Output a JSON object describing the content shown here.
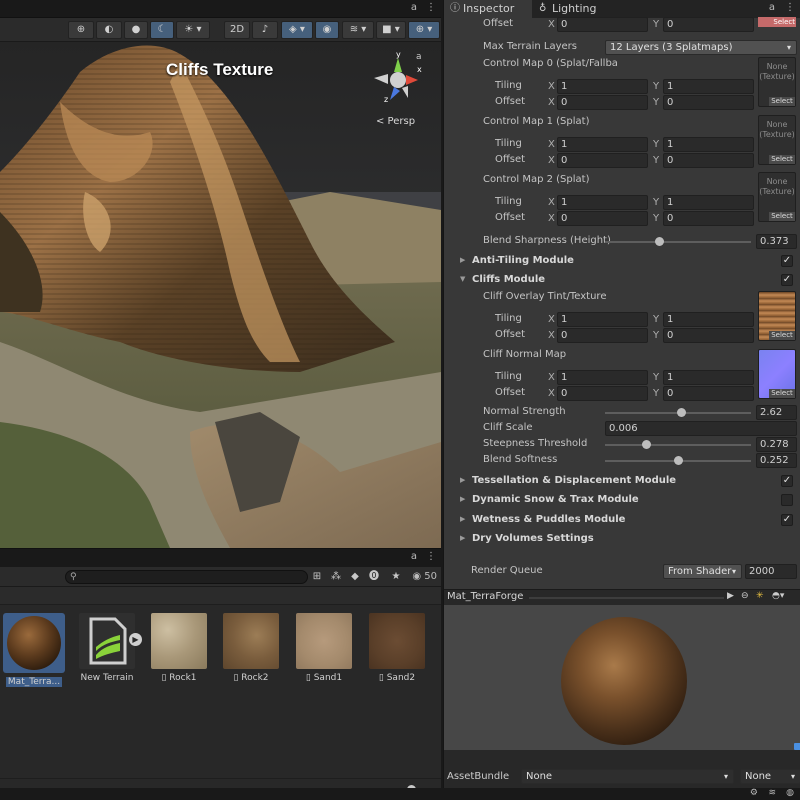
{
  "scene": {
    "overlay_title": "Cliffs Texture",
    "projection_label": "< Persp",
    "gizmo_axes": {
      "x": "x",
      "y": "y",
      "z": "z"
    },
    "toolbar_icons": [
      "globe-icon",
      "gizmo-mode-icon",
      "shaded-sphere-icon",
      "moon-icon",
      "sun-icon",
      "2d-icon",
      "audio-icon",
      "fx-layers-icon",
      "visibility-icon",
      "layers-icon",
      "camera-icon",
      "gizmos-icon"
    ],
    "toolbar_label_2d": "2D",
    "lock_glyph": "a",
    "menu_glyph": "⋮"
  },
  "project": {
    "search_placeholder": "",
    "hidden_count": "50",
    "assets": [
      {
        "label": "Mat_Terra...",
        "kind": "material",
        "selected": true
      },
      {
        "label": "New Terrain",
        "kind": "terrain",
        "selected": false
      },
      {
        "label": "Rock1",
        "kind": "texture",
        "selected": false
      },
      {
        "label": "Rock2",
        "kind": "texture",
        "selected": false
      },
      {
        "label": "Sand1",
        "kind": "texture",
        "selected": false
      },
      {
        "label": "Sand2",
        "kind": "texture",
        "selected": false
      }
    ]
  },
  "inspector": {
    "tabs": [
      {
        "label": "Inspector",
        "icon": "info-icon",
        "active": true
      },
      {
        "label": "Lighting",
        "icon": "bulb-icon",
        "active": false
      }
    ],
    "top_offset": {
      "label": "Offset",
      "x": "0",
      "y": "0",
      "select": "Select"
    },
    "max_layers": {
      "label": "Max Terrain Layers",
      "value": "12 Layers (3 Splatmaps)"
    },
    "control_maps": [
      {
        "label": "Control Map 0 (Splat/Fallba",
        "tiling_label": "Tiling",
        "tiling_x": "1",
        "tiling_y": "1",
        "offset_label": "Offset",
        "offset_x": "0",
        "offset_y": "0",
        "slot_text": "None (Texture)",
        "select": "Select"
      },
      {
        "label": "Control Map 1 (Splat)",
        "tiling_label": "Tiling",
        "tiling_x": "1",
        "tiling_y": "1",
        "offset_label": "Offset",
        "offset_x": "0",
        "offset_y": "0",
        "slot_text": "None (Texture)",
        "select": "Select"
      },
      {
        "label": "Control Map 2 (Splat)",
        "tiling_label": "Tiling",
        "tiling_x": "1",
        "tiling_y": "1",
        "offset_label": "Offset",
        "offset_x": "0",
        "offset_y": "0",
        "slot_text": "None (Texture)",
        "select": "Select"
      }
    ],
    "blend_sharpness": {
      "label": "Blend Sharpness (Height)",
      "value": "0.373",
      "fraction": 0.373
    },
    "anti_tiling": {
      "label": "Anti-Tiling Module",
      "checked": true
    },
    "cliffs": {
      "label": "Cliffs Module",
      "checked": true
    },
    "cliff_overlay": {
      "label": "Cliff Overlay Tint/Texture",
      "tiling_label": "Tiling",
      "tiling_x": "1",
      "tiling_y": "1",
      "offset_label": "Offset",
      "offset_x": "0",
      "offset_y": "0",
      "select": "Select"
    },
    "cliff_normal": {
      "label": "Cliff Normal Map",
      "tiling_label": "Tiling",
      "tiling_x": "1",
      "tiling_y": "1",
      "offset_label": "Offset",
      "offset_x": "0",
      "offset_y": "0",
      "select": "Select"
    },
    "normal_strength": {
      "label": "Normal Strength",
      "value": "2.62",
      "fraction": 0.52
    },
    "cliff_scale": {
      "label": "Cliff Scale",
      "value": "0.006"
    },
    "steepness": {
      "label": "Steepness Threshold",
      "value": "0.278",
      "fraction": 0.278
    },
    "blend_softness": {
      "label": "Blend Softness",
      "value": "0.252",
      "fraction": 0.5
    },
    "modules": [
      {
        "label": "Tessellation & Displacement Module",
        "checked": true
      },
      {
        "label": "Dynamic Snow & Trax Module",
        "checked": false
      },
      {
        "label": "Wetness & Puddles Module",
        "checked": true
      },
      {
        "label": "Dry Volumes Settings",
        "checked": null
      }
    ],
    "render_queue": {
      "label": "Render Queue",
      "mode": "From Shader",
      "value": "2000"
    },
    "preview_title": "Mat_TerraForge",
    "asset_bundle": {
      "label": "AssetBundle",
      "name": "None",
      "variant": "None"
    },
    "check_glyph": "✓",
    "x_label": "X",
    "y_label": "Y"
  }
}
